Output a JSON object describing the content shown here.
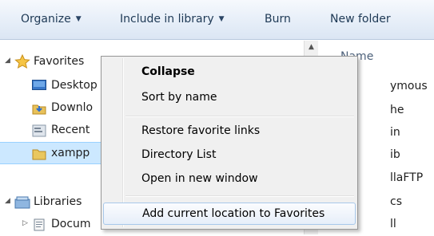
{
  "toolbar": {
    "organize": "Organize",
    "include_in_library": "Include in library",
    "burn": "Burn",
    "new_folder": "New folder"
  },
  "nav": {
    "favorites": "Favorites",
    "desktop": "Desktop",
    "downloads": "Downlo",
    "recent": "Recent",
    "xampp": "xampp",
    "libraries": "Libraries",
    "documents": "Docum"
  },
  "details": {
    "name_header": "Name",
    "fragments": [
      "ymous",
      "he",
      "in",
      "ib",
      "llaFTP",
      "cs",
      "ll"
    ]
  },
  "context_menu": {
    "items": [
      "Collapse",
      "Sort by name",
      "Restore favorite links",
      "Directory List",
      "Open in new window",
      "Add current location to Favorites"
    ]
  },
  "icons": {
    "favorites": "star-icon",
    "desktop": "desktop-icon",
    "downloads": "downloads-icon",
    "recent": "recent-places-icon",
    "xampp": "folder-icon",
    "libraries": "library-icon",
    "documents": "documents-icon"
  },
  "colors": {
    "toolbar_top": "#f6f9fd",
    "toolbar_bottom": "#dbe6f4",
    "selection": "#cce8ff",
    "menu_bg": "#f0f0f0",
    "menu_hover_border": "#a8c8ea"
  }
}
